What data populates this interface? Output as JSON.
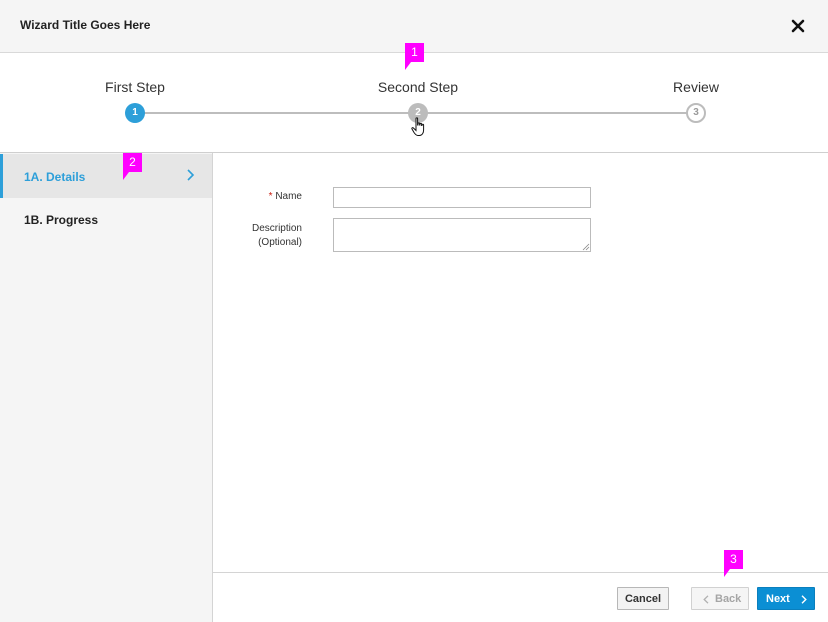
{
  "header": {
    "title": "Wizard Title Goes Here",
    "close_icon": "close-icon"
  },
  "steps": [
    {
      "label": "First Step",
      "number": "1",
      "state": "active"
    },
    {
      "label": "Second Step",
      "number": "2",
      "state": "hover"
    },
    {
      "label": "Review",
      "number": "3",
      "state": "future"
    }
  ],
  "sidebar": {
    "items": [
      {
        "label": "1A. Details",
        "active": true
      },
      {
        "label": "1B. Progress",
        "active": false
      }
    ]
  },
  "form": {
    "name_required_mark": "*",
    "name_label": "Name",
    "name_value": "",
    "description_label_line1": "Description",
    "description_label_line2": "(Optional)",
    "description_value": ""
  },
  "footer": {
    "cancel_label": "Cancel",
    "back_label": "Back",
    "next_label": "Next"
  },
  "annotations": [
    "1",
    "2",
    "3"
  ],
  "colors": {
    "accent": "#2d9fd9",
    "primary_button": "#0b8fd4",
    "required": "#c9190b",
    "annotation": "#ff00ff"
  }
}
